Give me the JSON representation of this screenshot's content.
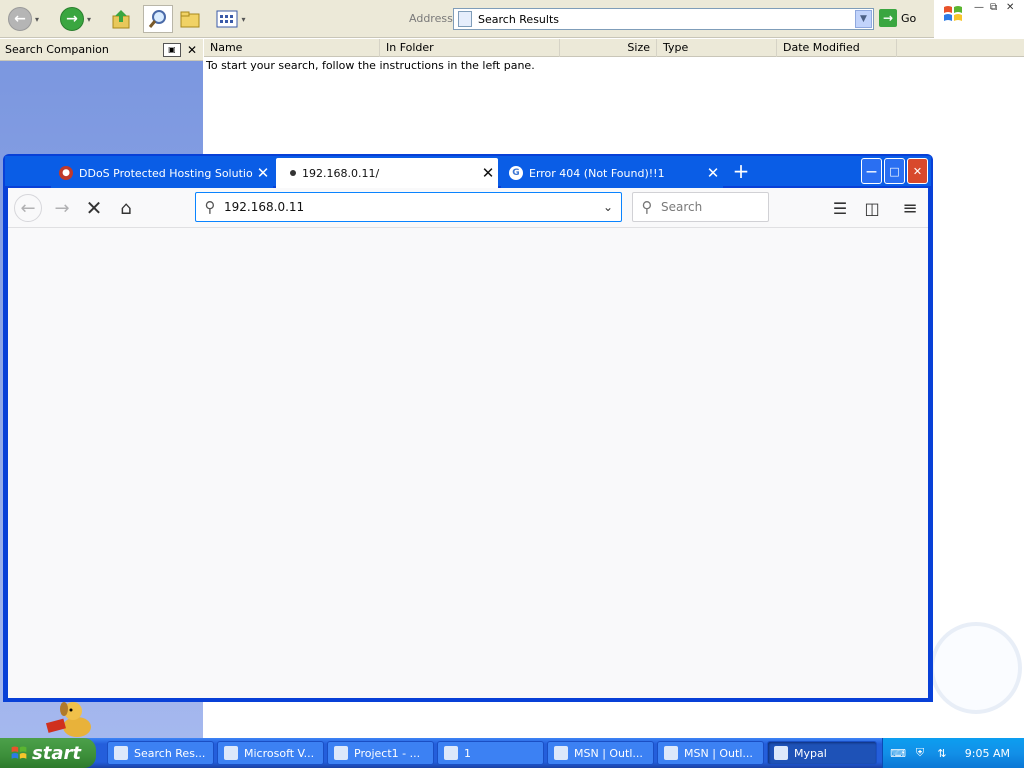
{
  "explorer": {
    "address_label": "Address",
    "address_value": "Search Results",
    "go_label": "Go",
    "sidebar_title": "Search Companion",
    "columns": [
      "Name",
      "In Folder",
      "Size",
      "Type",
      "Date Modified"
    ],
    "hint": "To start your search, follow the instructions in the left pane.",
    "icons": [
      "back-icon",
      "forward-icon",
      "up-folder-icon",
      "search-icon",
      "folders-icon",
      "views-icon"
    ]
  },
  "browser": {
    "tabs": [
      {
        "label": "DDoS Protected Hosting Solutions",
        "favicon": "ddos-favicon"
      },
      {
        "label": "192.168.0.11/",
        "favicon": "loading-dot"
      },
      {
        "label": "Error 404 (Not Found)!!1",
        "favicon": "G"
      }
    ],
    "active_tab": 1,
    "url": "192.168.0.11",
    "search_placeholder": "Search",
    "accent_color": "#0a84ff"
  },
  "taskbar": {
    "start_label": "start",
    "items": [
      {
        "label": "Search Res...",
        "active": false
      },
      {
        "label": "Microsoft V...",
        "active": false
      },
      {
        "label": "Project1 - ...",
        "active": false
      },
      {
        "label": "1",
        "active": false
      },
      {
        "label": "MSN | Outl...",
        "active": false
      },
      {
        "label": "MSN | Outl...",
        "active": false
      },
      {
        "label": "Mypal",
        "active": true
      }
    ],
    "clock": "9:05 AM"
  }
}
